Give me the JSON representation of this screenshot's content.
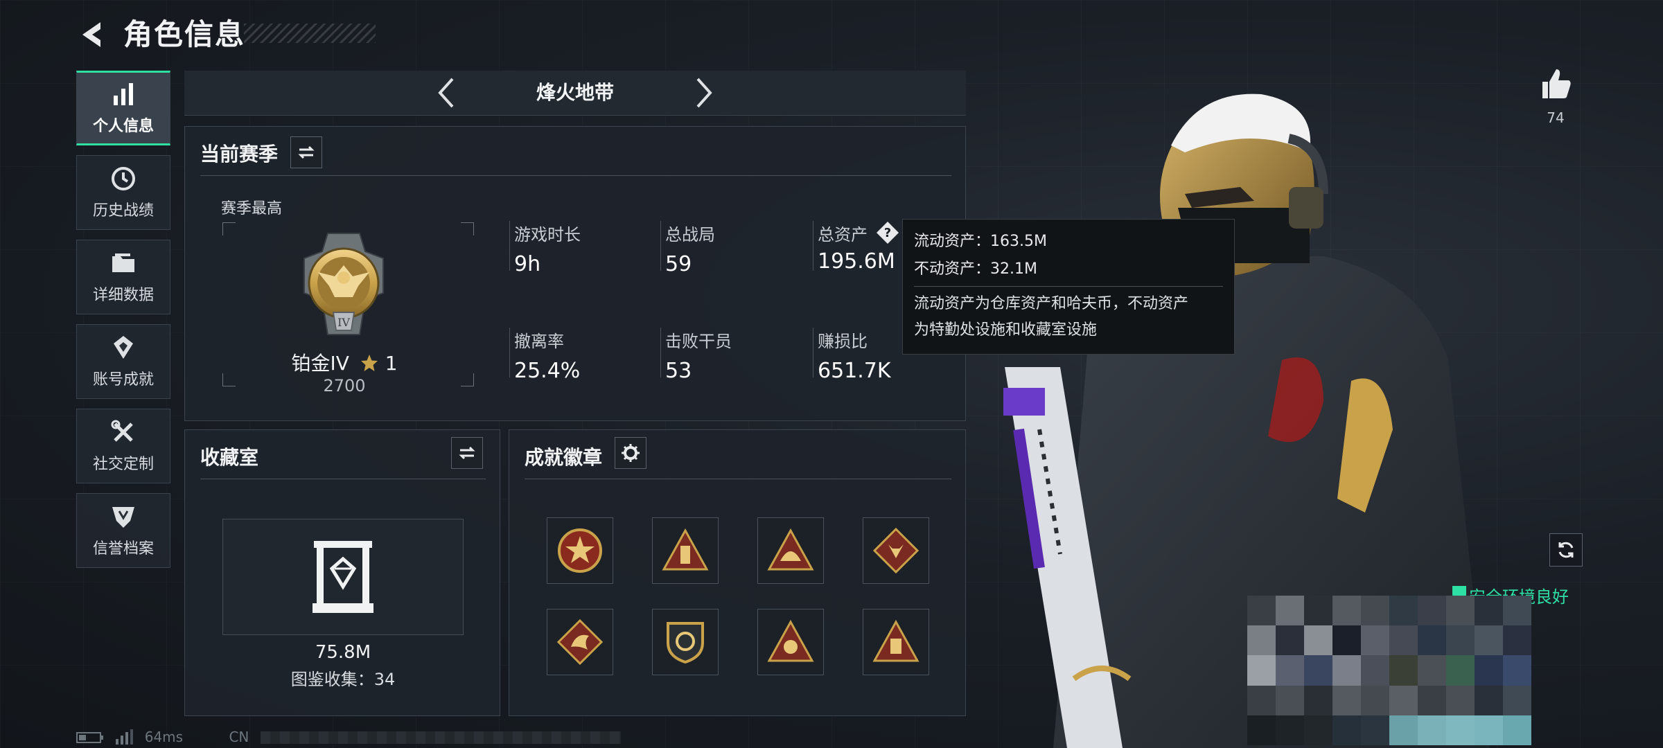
{
  "header": {
    "title": "角色信息"
  },
  "sidebar": {
    "items": [
      {
        "label": "个人信息",
        "icon": "bar-chart-icon",
        "active": true
      },
      {
        "label": "历史战绩",
        "icon": "clock-icon"
      },
      {
        "label": "详细数据",
        "icon": "folder-icon"
      },
      {
        "label": "账号成就",
        "icon": "achievement-icon"
      },
      {
        "label": "社交定制",
        "icon": "tools-icon"
      },
      {
        "label": "信誉档案",
        "icon": "shield-icon"
      }
    ]
  },
  "season_bar": {
    "name": "烽火地带"
  },
  "season_panel": {
    "title": "当前赛季",
    "best_label": "赛季最高",
    "rank_name": "铂金IV",
    "rank_stars": "1",
    "rank_score": "2700",
    "rank_roman": "IV",
    "stats": [
      {
        "label": "游戏时长",
        "value": "9h"
      },
      {
        "label": "总战局",
        "value": "59"
      },
      {
        "label": "总资产",
        "value": "195.6M"
      },
      {
        "label": "撤离率",
        "value": "25.4%"
      },
      {
        "label": "击败干员",
        "value": "53"
      },
      {
        "label": "赚损比",
        "value": "651.7K"
      }
    ]
  },
  "tooltip": {
    "liquid": "流动资产：163.5M",
    "fixed": "不动资产：32.1M",
    "desc_line1": "流动资产为仓库资产和哈夫币，不动资产",
    "desc_line2": "为特勤处设施和收藏室设施"
  },
  "collection_panel": {
    "title": "收藏室",
    "value": "75.8M",
    "count_text": "图鉴收集：34"
  },
  "badge_panel": {
    "title": "成就徽章",
    "badges": [
      {
        "icon": "star-emblem-icon"
      },
      {
        "icon": "triangle-tower-icon"
      },
      {
        "icon": "triangle-helmet-icon"
      },
      {
        "icon": "diamond-wolf-icon"
      },
      {
        "icon": "diamond-dragon-icon"
      },
      {
        "icon": "shield-crest-icon"
      },
      {
        "icon": "triangle-mask-icon"
      },
      {
        "icon": "triangle-card-icon"
      }
    ]
  },
  "likes": {
    "count": "74"
  },
  "environment": {
    "status": "安全环境良好"
  },
  "status_bar": {
    "ping": "64ms",
    "region": "CN"
  },
  "colors": {
    "accent": "#2fe0a5",
    "gold": "#c9a24a",
    "panel": "#1e242b"
  }
}
